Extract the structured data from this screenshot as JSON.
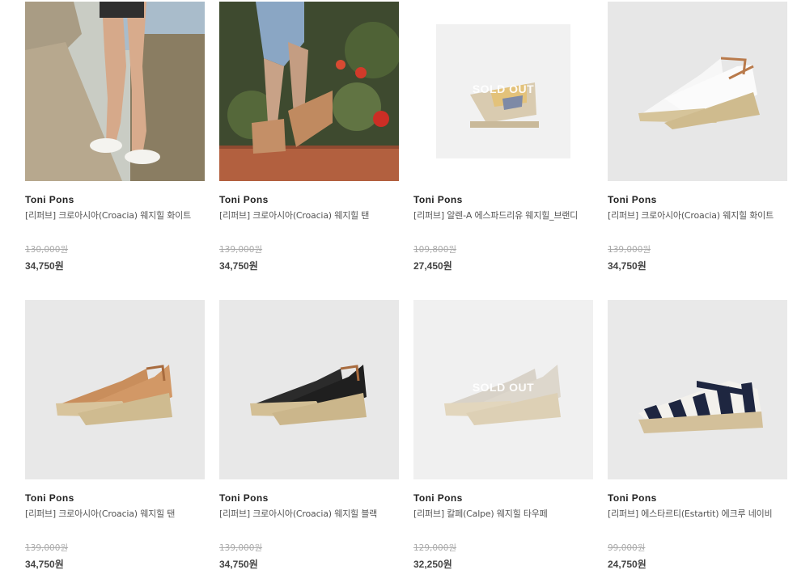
{
  "products": [
    {
      "brand": "Toni Pons",
      "name": "[리퍼브] 크로아시아(Croacia) 웨지힐 화이트",
      "original_price": "130,000원",
      "sale_price": "34,750원",
      "sold_out": false,
      "image": "lifestyle-croacia-white-on-wall"
    },
    {
      "brand": "Toni Pons",
      "name": "[리퍼브] 크로아시아(Croacia) 웨지힐 탠",
      "original_price": "139,000원",
      "sale_price": "34,750원",
      "sold_out": false,
      "image": "lifestyle-croacia-tan-with-flowers"
    },
    {
      "brand": "Toni Pons",
      "name": "[리퍼브] 알렌-A 에스파드리유 웨지힐_브랜디",
      "original_price": "109,800원",
      "sale_price": "27,450원",
      "sold_out": true,
      "sold_out_label": "SOLD OUT",
      "image": "wedge-brandy"
    },
    {
      "brand": "Toni Pons",
      "name": "[리퍼브] 크로아시아(Croacia) 웨지힐 화이트",
      "original_price": "139,000원",
      "sale_price": "34,750원",
      "sold_out": false,
      "image": "wedge-white-pair"
    },
    {
      "brand": "Toni Pons",
      "name": "[리퍼브] 크로아시아(Croacia) 웨지힐 탠",
      "original_price": "139,000원",
      "sale_price": "34,750원",
      "sold_out": false,
      "image": "wedge-tan-pair"
    },
    {
      "brand": "Toni Pons",
      "name": "[리퍼브] 크로아시아(Croacia) 웨지힐 블랙",
      "original_price": "139,000원",
      "sale_price": "34,750원",
      "sold_out": false,
      "image": "wedge-black-pair"
    },
    {
      "brand": "Toni Pons",
      "name": "[리퍼브] 칼페(Calpe) 웨지힐 타우페",
      "original_price": "129,000원",
      "sale_price": "32,250원",
      "sold_out": true,
      "sold_out_label": "SOLD OUT",
      "image": "wedge-taupe-pair"
    },
    {
      "brand": "Toni Pons",
      "name": "[리퍼브] 에스타르티(Estartit) 에크루 네이비",
      "original_price": "99,000원",
      "sale_price": "24,750원",
      "sold_out": false,
      "image": "espadrille-navy-stripe"
    }
  ],
  "colors": {
    "brand_text": "#222222",
    "name_text": "#555555",
    "original_price": "#aaaaaa",
    "sale_price": "#444444"
  }
}
